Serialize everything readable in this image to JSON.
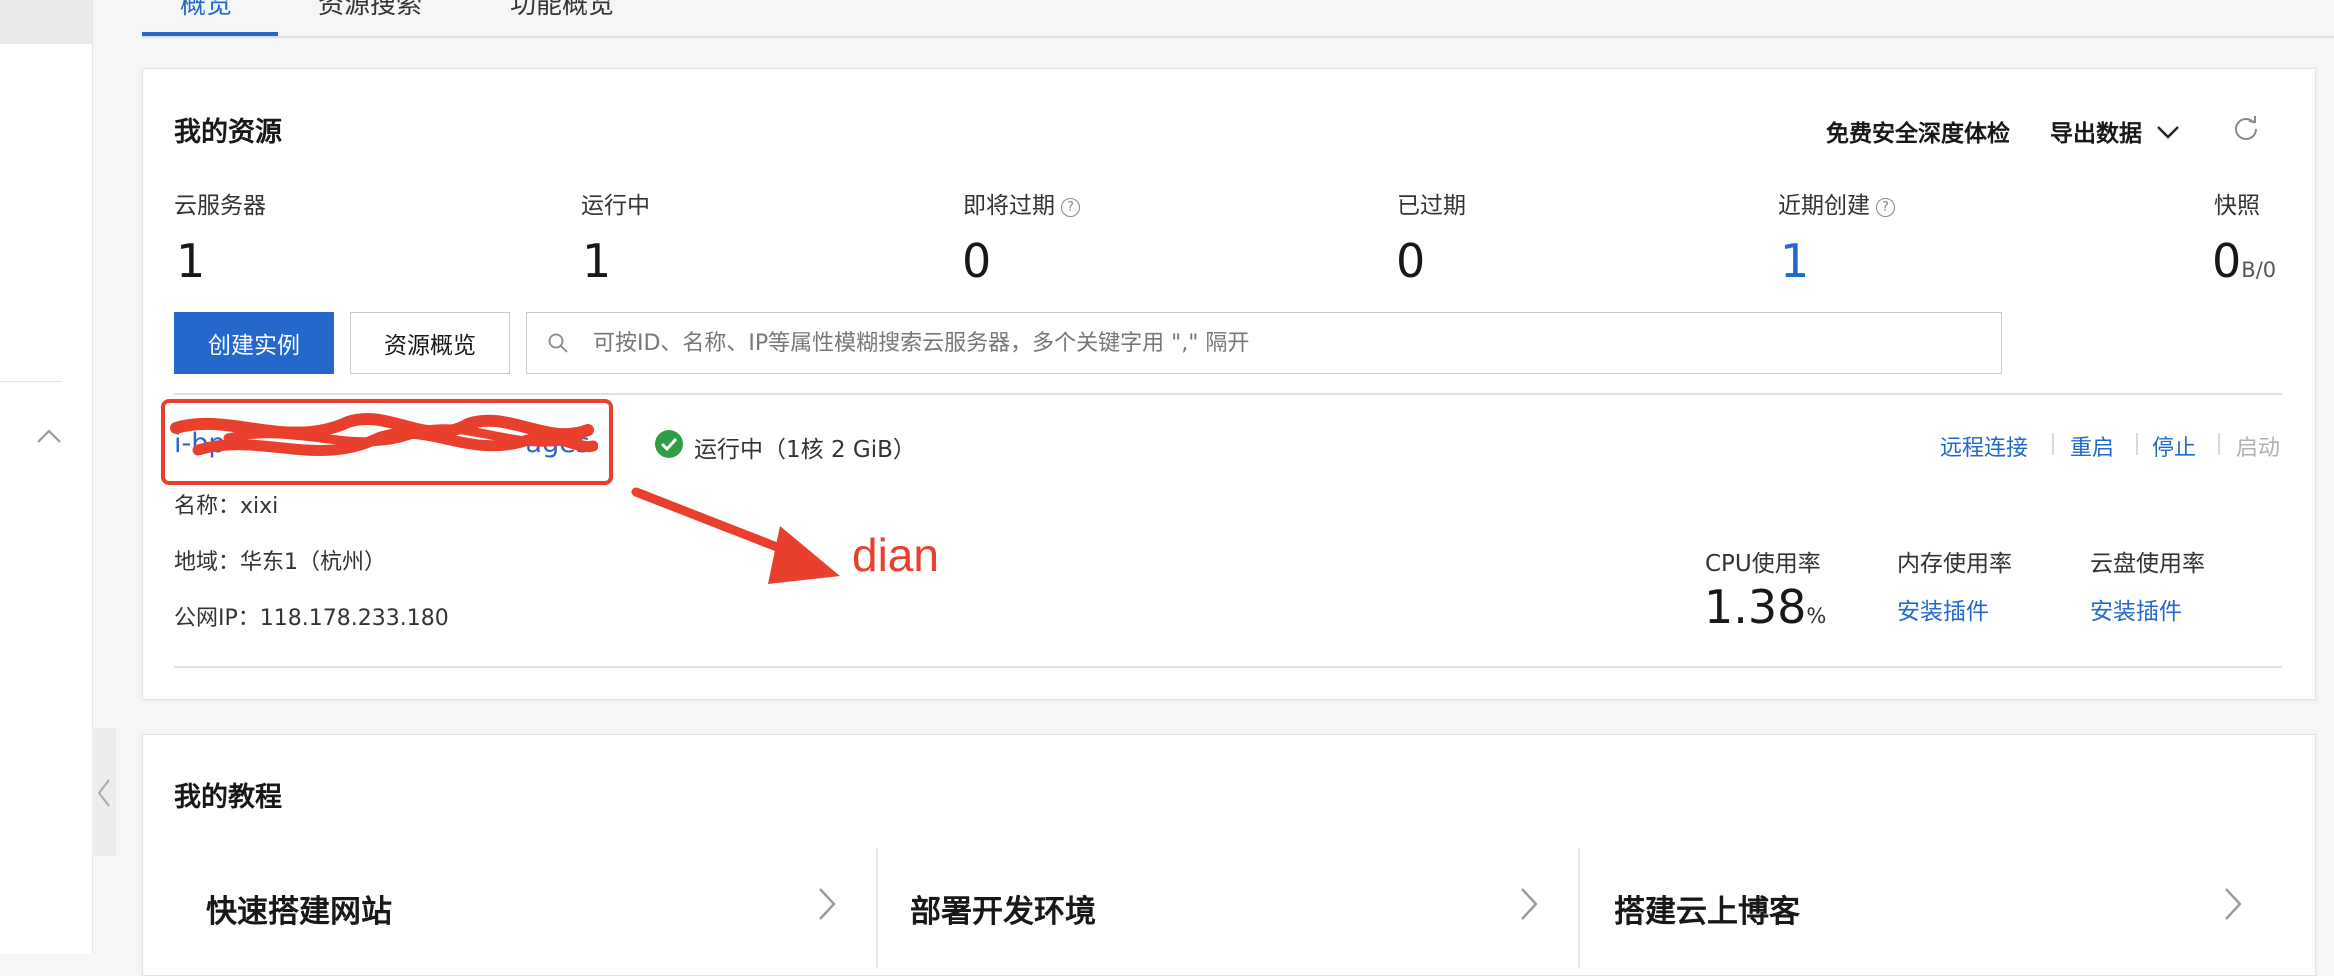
{
  "tabs": [
    {
      "label": "概览",
      "active": true
    },
    {
      "label": "资源搜索",
      "active": false
    },
    {
      "label": "功能概览",
      "active": false
    }
  ],
  "resources": {
    "title": "我的资源",
    "security_check": "免费安全深度体检",
    "export": "导出数据",
    "stats": [
      {
        "label": "云服务器",
        "value": "1"
      },
      {
        "label": "运行中",
        "value": "1"
      },
      {
        "label": "即将过期",
        "value": "0",
        "help": "?"
      },
      {
        "label": "已过期",
        "value": "0"
      },
      {
        "label": "近期创建",
        "value": "1",
        "help": "?",
        "color": "#2468cc"
      },
      {
        "label": "快照",
        "value": "0",
        "unit": "B/0"
      }
    ],
    "create_button": "创建实例",
    "overview_button": "资源概览",
    "search_placeholder": "可按ID、名称、IP等属性模糊搜索云服务器，多个关键字用 \",\" 隔开"
  },
  "instance": {
    "id_visible_prefix": "i-bp",
    "id_visible_suffix": "ages",
    "status": "运行中（1核 2 GiB）",
    "name": "名称：xixi",
    "region": "地域：华东1（杭州）",
    "public_ip": "公网IP：118.178.233.180",
    "actions": {
      "remote": "远程连接",
      "restart": "重启",
      "stop": "停止",
      "start": "启动"
    },
    "metrics": {
      "cpu_label": "CPU使用率",
      "cpu_value": "1.38",
      "cpu_unit": "%",
      "memory_label": "内存使用率",
      "memory_link": "安装插件",
      "disk_label": "云盘使用率",
      "disk_link": "安装插件"
    }
  },
  "annotation": {
    "text": "dian",
    "color": "#e8402d"
  },
  "tutorials": {
    "title": "我的教程",
    "items": [
      {
        "title": "快速搭建网站"
      },
      {
        "title": "部署开发环境"
      },
      {
        "title": "搭建云上博客"
      }
    ]
  },
  "colors": {
    "accent": "#2468cc",
    "success": "#2f9e44",
    "annotation_red": "#e8402d"
  }
}
